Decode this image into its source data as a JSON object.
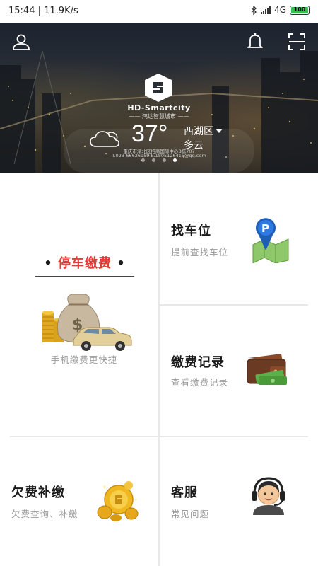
{
  "status_bar": {
    "time": "15:44",
    "speed": "11.9K/s",
    "network": "4G",
    "battery": "100"
  },
  "header": {
    "brand_en": "HD-Smartcity",
    "brand_cn": "—— 鸿达智慧城市 ——",
    "weather": {
      "temperature": "37°",
      "district": "西湖区",
      "condition": "多云",
      "icon": "cloud-icon"
    },
    "address_line1": "重庆市渝北区招商国际中心B栋707",
    "address_line2": "T.023-66626959  E.1805126415@qq.com",
    "carousel_count": 4,
    "carousel_active": 4
  },
  "tiles": {
    "parking_pay": {
      "title": "停车缴费",
      "subtitle": "手机缴费更快捷",
      "icon": "money-car-icon"
    },
    "find_space": {
      "title": "找车位",
      "subtitle": "提前查找车位",
      "icon": "parking-map-icon"
    },
    "pay_record": {
      "title": "缴费记录",
      "subtitle": "查看缴费记录",
      "icon": "wallet-icon"
    },
    "arrears": {
      "title": "欠费补缴",
      "subtitle": "欠费查询、补缴",
      "icon": "coins-icon"
    },
    "service": {
      "title": "客服",
      "subtitle": "常见问题",
      "icon": "support-agent-icon"
    }
  },
  "colors": {
    "accent_red": "#e53935",
    "divider": "#e8e8e8",
    "subtitle_gray": "#9a9a9a"
  }
}
